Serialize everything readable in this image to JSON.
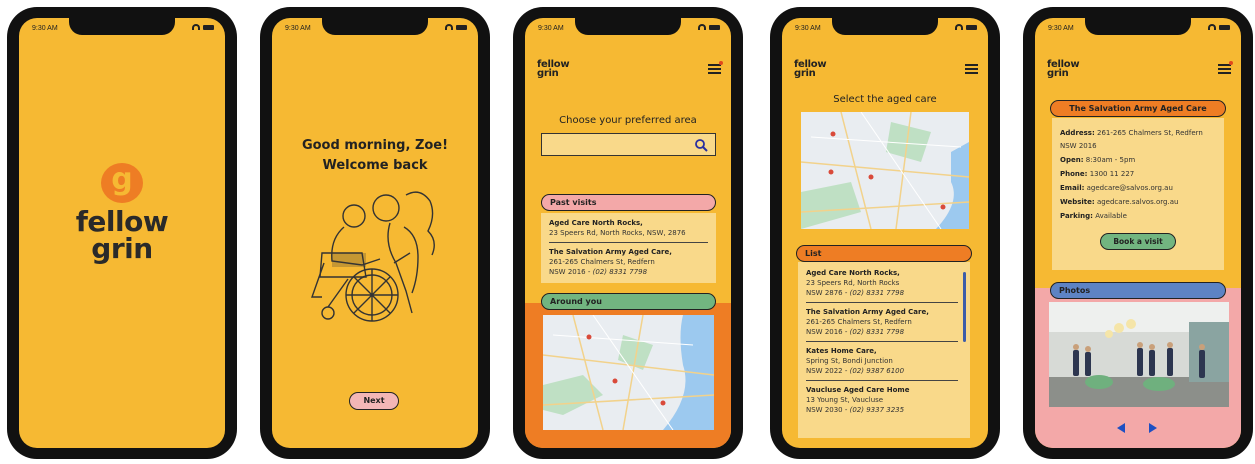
{
  "status": {
    "time": "9:30 AM"
  },
  "brand": {
    "line1": "fellow",
    "line2": "grin",
    "letter": "g"
  },
  "screen2": {
    "greeting": "Good morning, Zoe!",
    "welcome": "Welcome back",
    "next_label": "Next"
  },
  "screen3": {
    "prompt": "Choose your preferred area",
    "search_placeholder": "",
    "past_visits_label": "Past visits",
    "past_visits": [
      {
        "name": "Aged Care North Rocks,",
        "address": "23 Speers Rd, North Rocks, NSW, 2876"
      },
      {
        "name": "The Salvation Army Aged Care,",
        "address": "261-265 Chalmers St, Redfern",
        "line3": "NSW 2016  -  ",
        "phone": "(02) 8331 7798"
      }
    ],
    "around_label": "Around you"
  },
  "screen4": {
    "title": "Select the aged care",
    "list_label": "List",
    "items": [
      {
        "name": "Aged Care North Rocks,",
        "address": "23 Speers Rd, North Rocks",
        "line3": "NSW 2876  -  ",
        "phone": "(02) 8331 7798"
      },
      {
        "name": "The Salvation Army Aged Care,",
        "address": "261-265 Chalmers St, Redfern",
        "line3": "NSW 2016  -  ",
        "phone": "(02) 8331 7798"
      },
      {
        "name": "Kates Home Care,",
        "address": "Spring St, Bondi Junction",
        "line3": "NSW 2022  -  ",
        "phone": "(02) 9387 6100"
      },
      {
        "name": "Vaucluse Aged Care Home",
        "address": "13 Young St, Vaucluse",
        "line3": "NSW 2030  -  ",
        "phone": "(02) 9337 3235"
      }
    ]
  },
  "screen5": {
    "header": "The Salvation Army Aged Care",
    "address_label": "Address:",
    "address_value": "261-265 Chalmers St, Redfern NSW 2016",
    "open_label": "Open:",
    "open_value": "8:30am - 5pm",
    "phone_label": "Phone:",
    "phone_value": "1300 11 227",
    "email_label": "Email:",
    "email_value": "agedcare@salvos.org.au",
    "website_label": "Website:",
    "website_value": "agedcare.salvos.org.au",
    "parking_label": "Parking:",
    "parking_value": "Available",
    "book_label": "Book a visit",
    "photos_label": "Photos"
  },
  "colors": {
    "background": "#f6b933",
    "accent_orange": "#ee7d24",
    "past_visits_pink": "#f3a8a8",
    "around_green": "#72b580",
    "photos_blue": "#5d83c4",
    "card": "#f9d98a",
    "nav_arrow": "#1e4fc2"
  }
}
